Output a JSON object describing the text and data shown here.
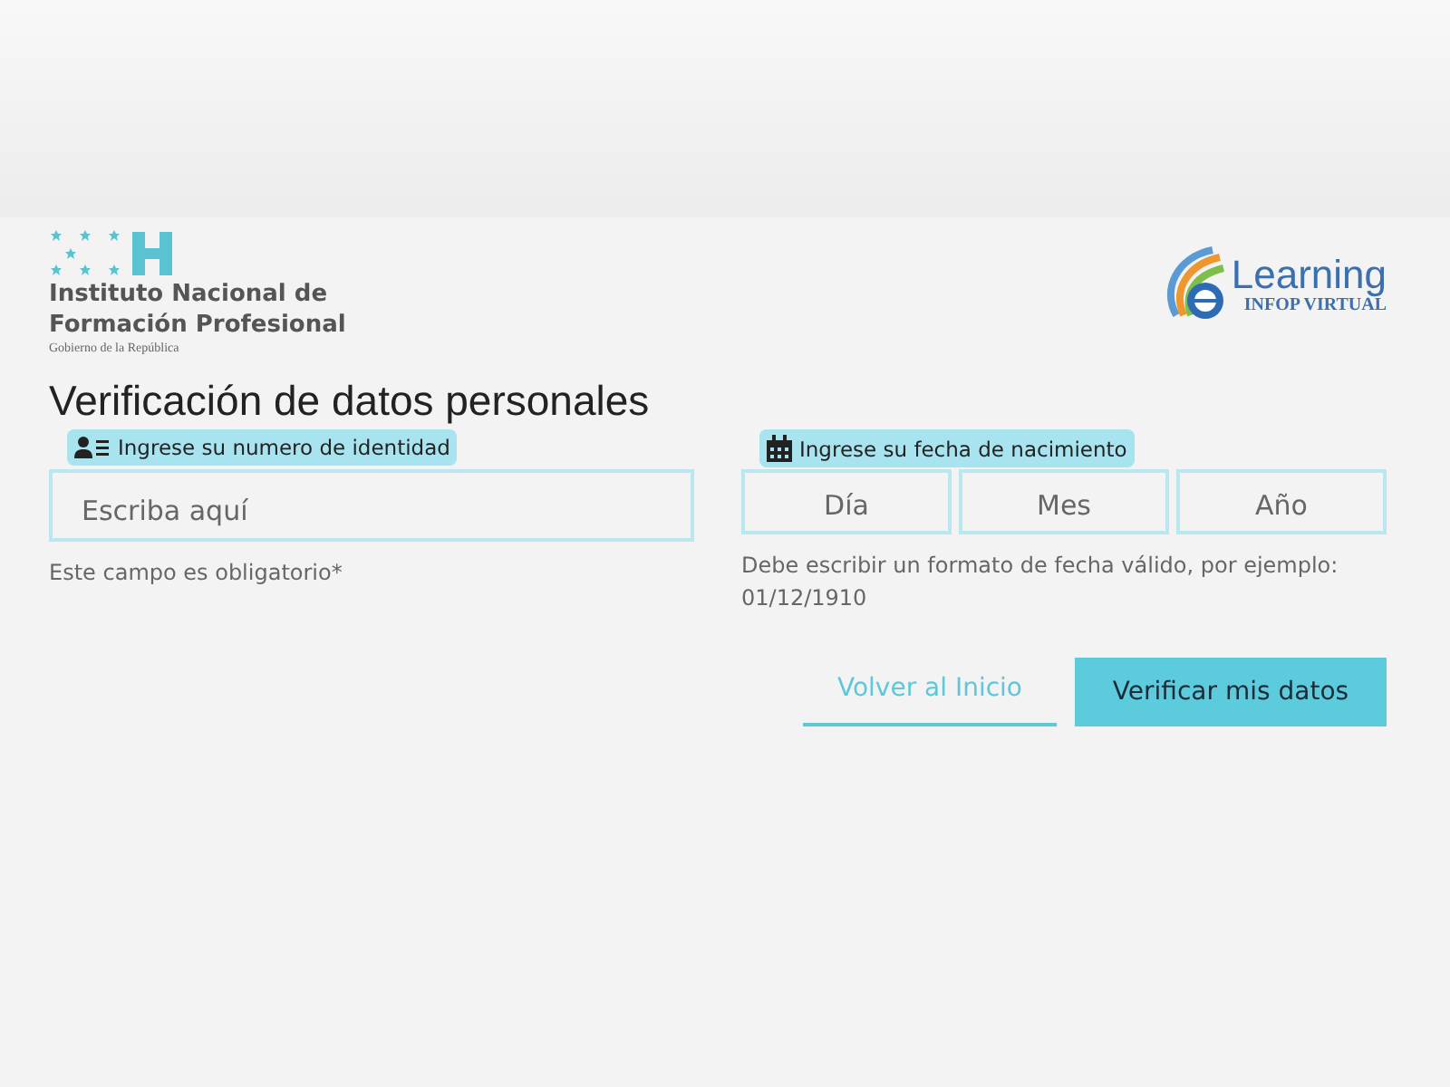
{
  "header": {
    "institution": {
      "line_1": "Instituto Nacional de",
      "line_2": "Formación Profesional",
      "subtitle": "Gobierno de la República"
    },
    "elearning": {
      "title": "Learning",
      "subtitle": "INFOP VIRTUAL"
    }
  },
  "heading": "Verificación de datos personales",
  "identity": {
    "label": "Ingrese su numero de identidad",
    "placeholder": "Escriba aquí",
    "hint": "Este campo es obligatorio*"
  },
  "birth_date": {
    "label": "Ingrese su fecha de nacimiento",
    "fields": [
      {
        "placeholder": "Día"
      },
      {
        "placeholder": "Mes"
      },
      {
        "placeholder": "Año"
      }
    ],
    "hint": "Debe escribir un formato de fecha válido, por ejemplo: 01/12/1910"
  },
  "buttons": [
    {
      "label": "Volver al Inicio",
      "kind": "link"
    },
    {
      "label": "Verificar mis datos",
      "kind": "primary"
    }
  ]
}
